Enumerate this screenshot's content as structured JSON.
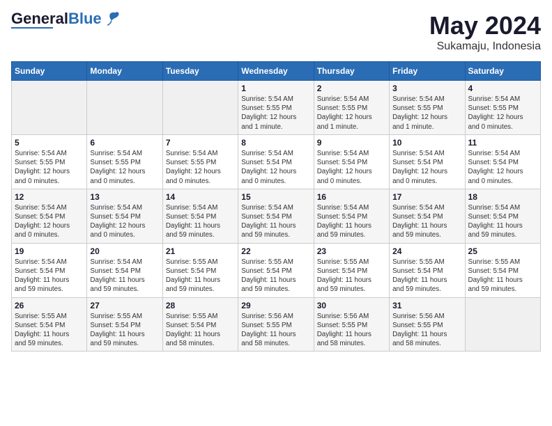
{
  "header": {
    "logo_general": "General",
    "logo_blue": "Blue",
    "title": "May 2024",
    "subtitle": "Sukamaju, Indonesia"
  },
  "calendar": {
    "weekdays": [
      "Sunday",
      "Monday",
      "Tuesday",
      "Wednesday",
      "Thursday",
      "Friday",
      "Saturday"
    ],
    "weeks": [
      [
        {
          "day": "",
          "info": ""
        },
        {
          "day": "",
          "info": ""
        },
        {
          "day": "",
          "info": ""
        },
        {
          "day": "1",
          "info": "Sunrise: 5:54 AM\nSunset: 5:55 PM\nDaylight: 12 hours\nand 1 minute."
        },
        {
          "day": "2",
          "info": "Sunrise: 5:54 AM\nSunset: 5:55 PM\nDaylight: 12 hours\nand 1 minute."
        },
        {
          "day": "3",
          "info": "Sunrise: 5:54 AM\nSunset: 5:55 PM\nDaylight: 12 hours\nand 1 minute."
        },
        {
          "day": "4",
          "info": "Sunrise: 5:54 AM\nSunset: 5:55 PM\nDaylight: 12 hours\nand 0 minutes."
        }
      ],
      [
        {
          "day": "5",
          "info": "Sunrise: 5:54 AM\nSunset: 5:55 PM\nDaylight: 12 hours\nand 0 minutes."
        },
        {
          "day": "6",
          "info": "Sunrise: 5:54 AM\nSunset: 5:55 PM\nDaylight: 12 hours\nand 0 minutes."
        },
        {
          "day": "7",
          "info": "Sunrise: 5:54 AM\nSunset: 5:55 PM\nDaylight: 12 hours\nand 0 minutes."
        },
        {
          "day": "8",
          "info": "Sunrise: 5:54 AM\nSunset: 5:54 PM\nDaylight: 12 hours\nand 0 minutes."
        },
        {
          "day": "9",
          "info": "Sunrise: 5:54 AM\nSunset: 5:54 PM\nDaylight: 12 hours\nand 0 minutes."
        },
        {
          "day": "10",
          "info": "Sunrise: 5:54 AM\nSunset: 5:54 PM\nDaylight: 12 hours\nand 0 minutes."
        },
        {
          "day": "11",
          "info": "Sunrise: 5:54 AM\nSunset: 5:54 PM\nDaylight: 12 hours\nand 0 minutes."
        }
      ],
      [
        {
          "day": "12",
          "info": "Sunrise: 5:54 AM\nSunset: 5:54 PM\nDaylight: 12 hours\nand 0 minutes."
        },
        {
          "day": "13",
          "info": "Sunrise: 5:54 AM\nSunset: 5:54 PM\nDaylight: 12 hours\nand 0 minutes."
        },
        {
          "day": "14",
          "info": "Sunrise: 5:54 AM\nSunset: 5:54 PM\nDaylight: 11 hours\nand 59 minutes."
        },
        {
          "day": "15",
          "info": "Sunrise: 5:54 AM\nSunset: 5:54 PM\nDaylight: 11 hours\nand 59 minutes."
        },
        {
          "day": "16",
          "info": "Sunrise: 5:54 AM\nSunset: 5:54 PM\nDaylight: 11 hours\nand 59 minutes."
        },
        {
          "day": "17",
          "info": "Sunrise: 5:54 AM\nSunset: 5:54 PM\nDaylight: 11 hours\nand 59 minutes."
        },
        {
          "day": "18",
          "info": "Sunrise: 5:54 AM\nSunset: 5:54 PM\nDaylight: 11 hours\nand 59 minutes."
        }
      ],
      [
        {
          "day": "19",
          "info": "Sunrise: 5:54 AM\nSunset: 5:54 PM\nDaylight: 11 hours\nand 59 minutes."
        },
        {
          "day": "20",
          "info": "Sunrise: 5:54 AM\nSunset: 5:54 PM\nDaylight: 11 hours\nand 59 minutes."
        },
        {
          "day": "21",
          "info": "Sunrise: 5:55 AM\nSunset: 5:54 PM\nDaylight: 11 hours\nand 59 minutes."
        },
        {
          "day": "22",
          "info": "Sunrise: 5:55 AM\nSunset: 5:54 PM\nDaylight: 11 hours\nand 59 minutes."
        },
        {
          "day": "23",
          "info": "Sunrise: 5:55 AM\nSunset: 5:54 PM\nDaylight: 11 hours\nand 59 minutes."
        },
        {
          "day": "24",
          "info": "Sunrise: 5:55 AM\nSunset: 5:54 PM\nDaylight: 11 hours\nand 59 minutes."
        },
        {
          "day": "25",
          "info": "Sunrise: 5:55 AM\nSunset: 5:54 PM\nDaylight: 11 hours\nand 59 minutes."
        }
      ],
      [
        {
          "day": "26",
          "info": "Sunrise: 5:55 AM\nSunset: 5:54 PM\nDaylight: 11 hours\nand 59 minutes."
        },
        {
          "day": "27",
          "info": "Sunrise: 5:55 AM\nSunset: 5:54 PM\nDaylight: 11 hours\nand 59 minutes."
        },
        {
          "day": "28",
          "info": "Sunrise: 5:55 AM\nSunset: 5:54 PM\nDaylight: 11 hours\nand 58 minutes."
        },
        {
          "day": "29",
          "info": "Sunrise: 5:56 AM\nSunset: 5:55 PM\nDaylight: 11 hours\nand 58 minutes."
        },
        {
          "day": "30",
          "info": "Sunrise: 5:56 AM\nSunset: 5:55 PM\nDaylight: 11 hours\nand 58 minutes."
        },
        {
          "day": "31",
          "info": "Sunrise: 5:56 AM\nSunset: 5:55 PM\nDaylight: 11 hours\nand 58 minutes."
        },
        {
          "day": "",
          "info": ""
        }
      ]
    ]
  }
}
